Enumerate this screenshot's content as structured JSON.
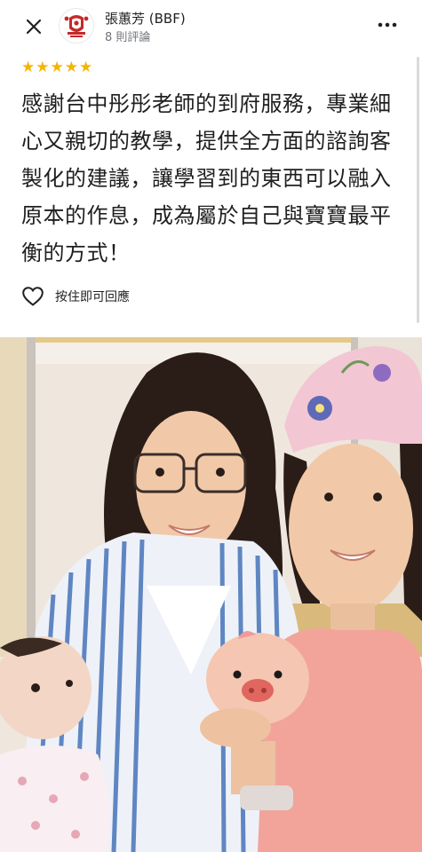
{
  "header": {
    "reviewer_name": "張蕙芳 (BBF)",
    "review_count": "8 則評論",
    "close_icon": "close-icon",
    "more_icon": "more-horizontal-icon"
  },
  "review": {
    "rating": 5,
    "stars": [
      "★",
      "★",
      "★",
      "★",
      "★"
    ],
    "star_color": "#f5b400",
    "text": "感謝台中彤彤老師的到府服務，專業細心又親切的教學，提供全方面的諮詢客製化的建議，讓學習到的東西可以融入原本的作息，成為屬於自己與寶寶最平衡的方式！"
  },
  "actions": {
    "like_label": "按住即可回應",
    "like_icon": "heart-outline-icon"
  },
  "photo": {
    "kind": "review-photo",
    "description_icon": "photo-icon"
  }
}
